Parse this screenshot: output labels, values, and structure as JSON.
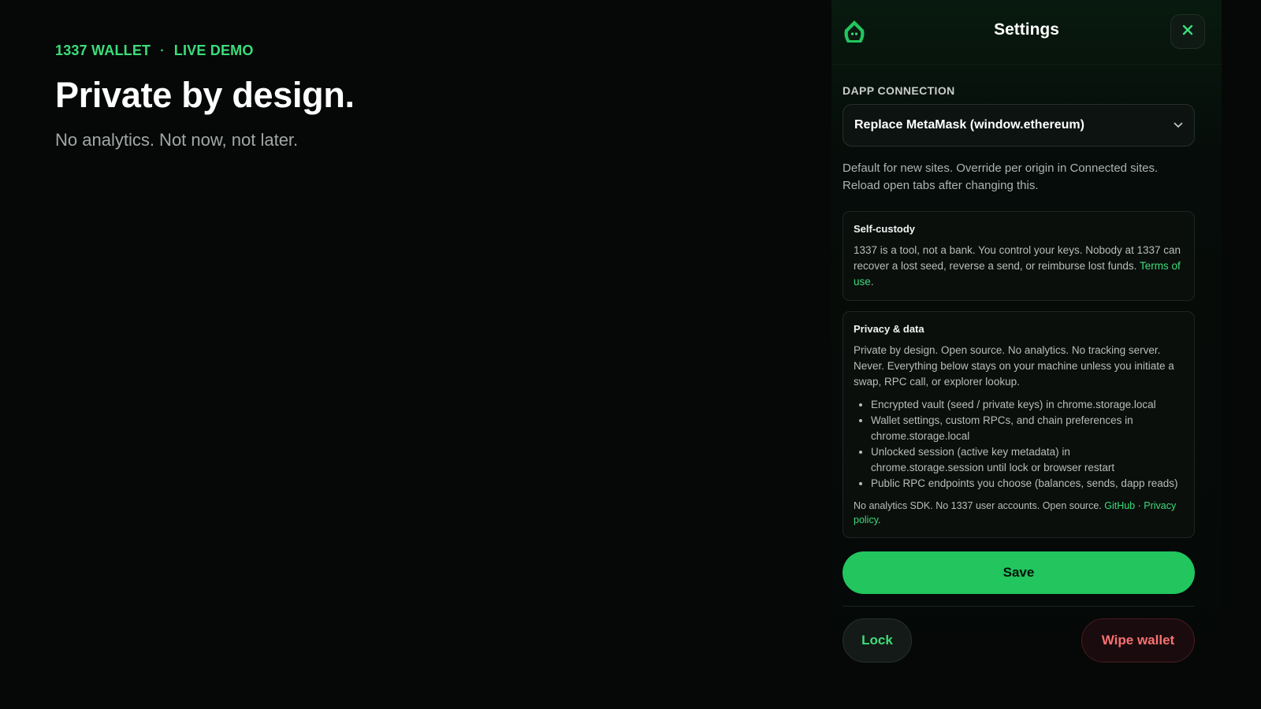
{
  "hero": {
    "brand": "1337 WALLET",
    "separator": "·",
    "badge": "LIVE DEMO",
    "title": "Private by design.",
    "subtitle": "No analytics. Not now, not later."
  },
  "settings": {
    "title": "Settings",
    "logo_icon": "hooded-figure-logo",
    "close_icon": "close-icon",
    "dapp_connection": {
      "label": "DAPP CONNECTION",
      "selected": "Replace MetaMask (window.ethereum)",
      "help_line1": "Default for new sites. Override per origin in Connected sites.",
      "help_line2": "Reload open tabs after changing this."
    },
    "self_custody": {
      "title": "Self-custody",
      "text": "1337 is a tool, not a bank. You control your keys. Nobody at 1337 can recover a lost seed, reverse a send, or reimburse lost funds.",
      "terms_link": "Terms of use",
      "terms_suffix": "."
    },
    "privacy": {
      "title": "Privacy & data",
      "text": "Private by design. Open source. No analytics. No tracking server. Never. Everything below stays on your machine unless you initiate a swap, RPC call, or explorer lookup.",
      "items": [
        "Encrypted vault (seed / private keys) in chrome.storage.local",
        "Wallet settings, custom RPCs, and chain preferences in chrome.storage.local",
        "Unlocked session (active key metadata) in chrome.storage.session until lock or browser restart",
        "Public RPC endpoints you choose (balances, sends, dapp reads)"
      ],
      "footer_text": "No analytics SDK. No 1337 user accounts. Open source. ",
      "github_link": "GitHub",
      "footer_sep": " · ",
      "privacy_link": "Privacy policy",
      "footer_suffix": "."
    },
    "save_label": "Save",
    "lock_label": "Lock",
    "wipe_label": "Wipe wallet"
  },
  "colors": {
    "accent": "#22c55e",
    "accent_text": "#3ddc7a",
    "danger": "#f87171",
    "background": "#050807"
  }
}
